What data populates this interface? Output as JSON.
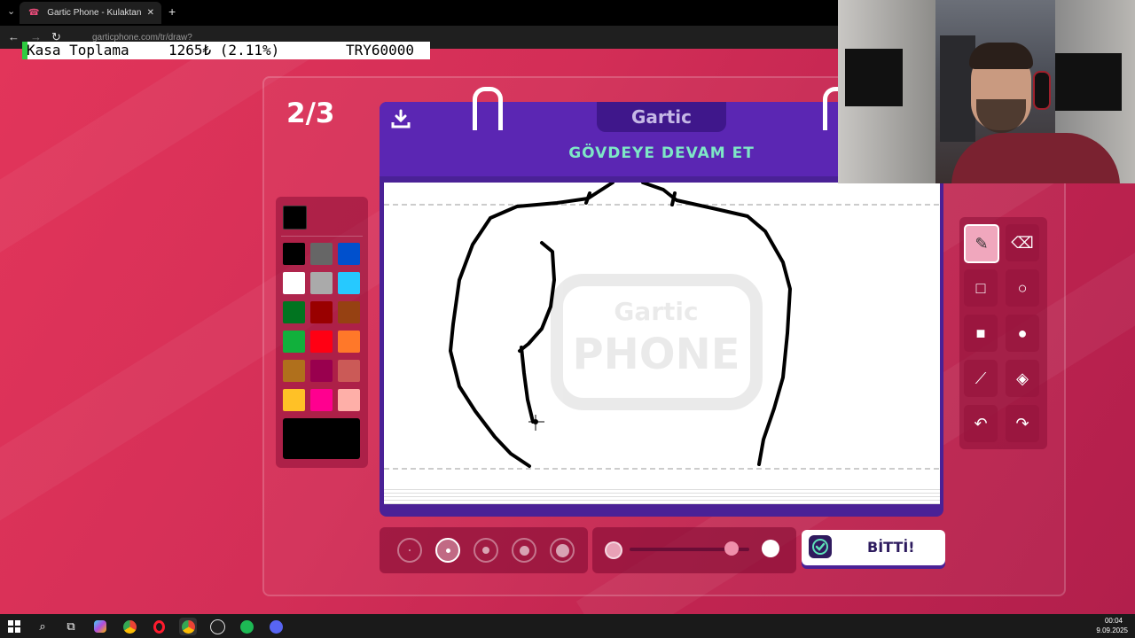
{
  "browser": {
    "tab_title": "Gartic Phone - Kulaktan Kulağa",
    "tab_close": "✕",
    "new_tab": "+",
    "url": "garticphone.com/tr/draw?"
  },
  "overlay": {
    "label": "Kasa Toplama",
    "amount": "1265₺ (2.11%)",
    "goal": "TRY60000"
  },
  "game": {
    "round": "2/3",
    "brand": "Gartic",
    "prompt": "GÖVDEYE DEVAM ET",
    "watermark_top": "Gartic",
    "watermark_bottom": "PHONE",
    "done_label": "BİTTİ!",
    "selected_color": "#000000",
    "palette": [
      "#000000",
      "#666666",
      "#0050cd",
      "#ffffff",
      "#aaaaaa",
      "#26c9ff",
      "#017420",
      "#990000",
      "#964112",
      "#11b03c",
      "#ff0013",
      "#ff7829",
      "#b0701c",
      "#99004e",
      "#cb5a57",
      "#ffc126",
      "#ff008f",
      "#feafa8"
    ],
    "tools": [
      {
        "name": "pencil-icon",
        "glyph": "✎",
        "selected": true
      },
      {
        "name": "eraser-icon",
        "glyph": "⌫",
        "selected": false
      },
      {
        "name": "rectangle-outline-icon",
        "glyph": "□",
        "selected": false
      },
      {
        "name": "circle-outline-icon",
        "glyph": "○",
        "selected": false
      },
      {
        "name": "rectangle-filled-icon",
        "glyph": "■",
        "selected": false
      },
      {
        "name": "circle-filled-icon",
        "glyph": "●",
        "selected": false
      },
      {
        "name": "line-icon",
        "glyph": "⟋",
        "selected": false
      },
      {
        "name": "fill-bucket-icon",
        "glyph": "◈",
        "selected": false
      },
      {
        "name": "undo-icon",
        "glyph": "↶",
        "selected": false
      },
      {
        "name": "redo-icon",
        "glyph": "↷",
        "selected": false
      }
    ],
    "brush_sizes_selected_index": 1,
    "opacity_level": 0.85
  },
  "taskbar": {
    "time": "00:04",
    "date": "9.09.2025"
  }
}
